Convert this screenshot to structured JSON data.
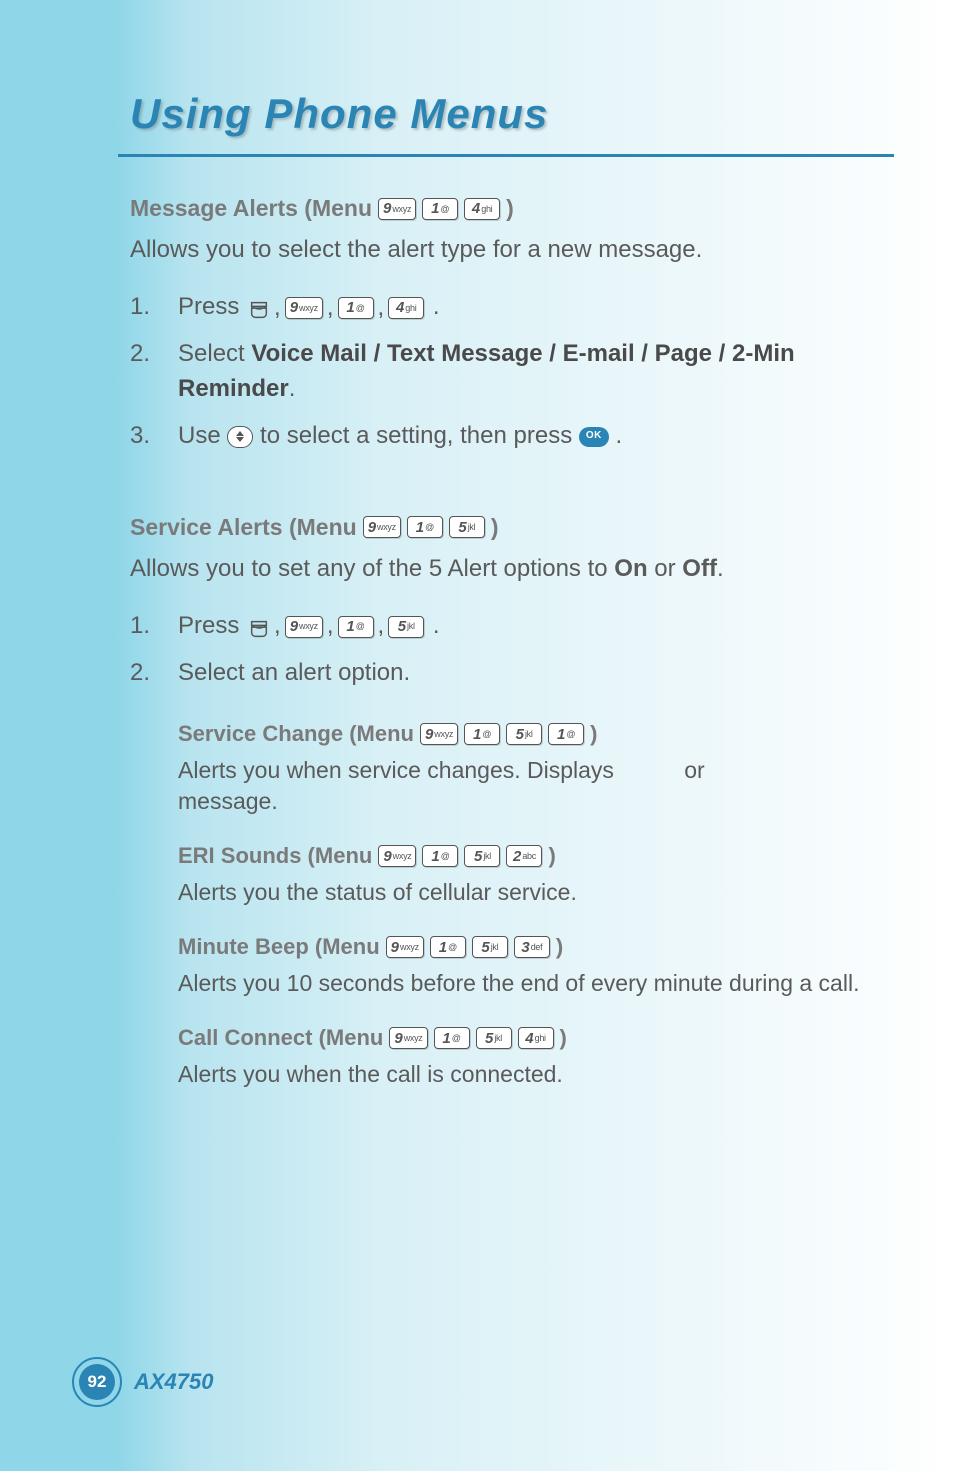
{
  "chapter_title": "Using Phone Menus",
  "page_number": "92",
  "model": "AX4750",
  "sections": {
    "message_alerts": {
      "heading_prefix": "Message Alerts (Menu ",
      "heading_suffix": " )",
      "keys": [
        "9wxyz",
        "1@",
        "4ghi"
      ],
      "desc": "Allows you to select the alert type for a new message.",
      "steps": [
        {
          "num": "1.",
          "prefix": "Press ",
          "keys": [
            "menu",
            "9wxyz",
            "1@",
            "4ghi"
          ],
          "suffix": "."
        },
        {
          "num": "2.",
          "text_a": "Select ",
          "bold": "Voice Mail / Text Message / E-mail / Page / 2-Min Reminder",
          "text_b": "."
        },
        {
          "num": "3.",
          "text_a": "Use ",
          "icon": "nav",
          "text_b": " to select a setting, then press ",
          "icon2": "ok",
          "text_c": "."
        }
      ]
    },
    "service_alerts": {
      "heading_prefix": "Service Alerts (Menu ",
      "heading_suffix": " )",
      "keys": [
        "9wxyz",
        "1@",
        "5jkl"
      ],
      "desc_a": "Allows you to set any of the 5 Alert options to ",
      "on": "On",
      "or": " or ",
      "off": "Off",
      "desc_b": ".",
      "steps": [
        {
          "num": "1.",
          "prefix": "Press ",
          "keys": [
            "menu",
            "9wxyz",
            "1@",
            "5jkl"
          ],
          "suffix": "."
        },
        {
          "num": "2.",
          "text": "Select an alert option."
        }
      ],
      "sub": [
        {
          "heading_prefix": "Service Change (Menu ",
          "heading_suffix": " )",
          "keys": [
            "9wxyz",
            "1@",
            "5jkl",
            "1@"
          ],
          "desc": "Alerts you when service changes. Displays           or                                message."
        },
        {
          "heading_prefix": "ERI Sounds (Menu ",
          "heading_suffix": " )",
          "keys": [
            "9wxyz",
            "1@",
            "5jkl",
            "2abc"
          ],
          "desc": "Alerts you the status of cellular service."
        },
        {
          "heading_prefix": "Minute Beep (Menu ",
          "heading_suffix": " )",
          "keys": [
            "9wxyz",
            "1@",
            "5jkl",
            "3def"
          ],
          "desc": "Alerts you 10 seconds before the end of every minute during a call."
        },
        {
          "heading_prefix": "Call Connect (Menu ",
          "heading_suffix": " )",
          "keys": [
            "9wxyz",
            "1@",
            "5jkl",
            "4ghi"
          ],
          "desc": "Alerts you when the call is connected."
        }
      ]
    }
  },
  "key_labels": {
    "1@": {
      "main": "1",
      "sub": "@"
    },
    "2abc": {
      "main": "2",
      "sub": "abc"
    },
    "3def": {
      "main": "3",
      "sub": "def"
    },
    "4ghi": {
      "main": "4",
      "sub": "ghi"
    },
    "5jkl": {
      "main": "5",
      "sub": "jkl"
    },
    "9wxyz": {
      "main": "9",
      "sub": "wxyz"
    }
  },
  "ok_label": "OK"
}
